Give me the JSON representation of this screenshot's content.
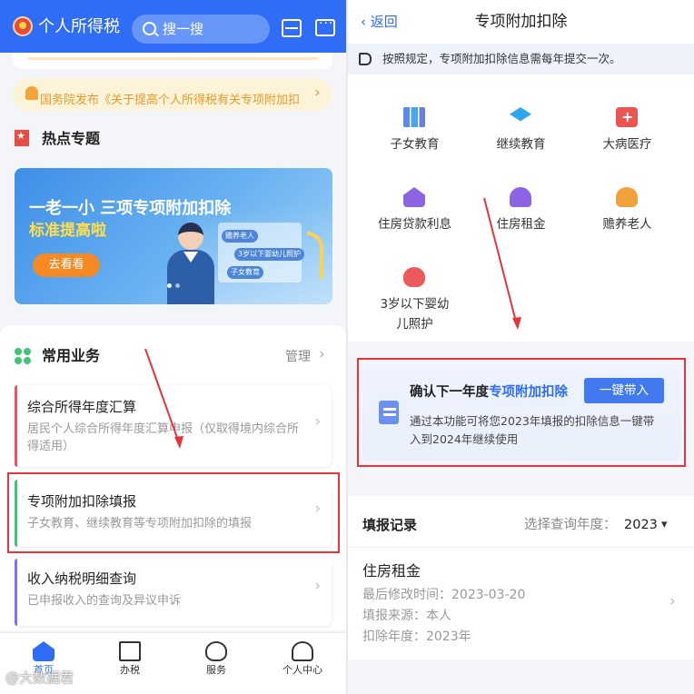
{
  "left_screen": {
    "header": {
      "app_title": "个人所得税",
      "search_placeholder": "搜一搜"
    },
    "notice": {
      "text": "国务院发布《关于提高个人所得税有关专项附加扣"
    },
    "hot_topics": {
      "title": "热点专题",
      "banner": {
        "title": "一老一小 三项专项附加扣除",
        "subtitle": "标准提高啦",
        "button": "去看看",
        "tags": [
          "赡养老人",
          "3岁以下婴幼儿照护",
          "子女教育"
        ]
      }
    },
    "common_services": {
      "title": "常用业务",
      "manage_label": "管理",
      "cards": [
        {
          "title": "综合所得年度汇算",
          "desc": "居民个人综合所得年度汇算申报（仅取得境内综合所得适用）",
          "accent": "#e8536a"
        },
        {
          "title": "专项附加扣除填报",
          "desc": "子女教育、继续教育等专项附加扣除的填报",
          "accent": "#3cc67a"
        },
        {
          "title": "收入纳税明细查询",
          "desc": "已申报收入的查询及异议申诉",
          "accent": "#8b6ef0"
        }
      ]
    },
    "tabbar": [
      {
        "label": "首页",
        "icon": "home-icon",
        "active": true
      },
      {
        "label": "办税",
        "icon": "tax-icon",
        "active": false
      },
      {
        "label": "服务",
        "icon": "service-icon",
        "active": false
      },
      {
        "label": "个人中心",
        "icon": "user-icon",
        "active": false
      }
    ],
    "watermark": "@大数据君"
  },
  "right_screen": {
    "header": {
      "back_label": "返回",
      "title": "专项附加扣除"
    },
    "tip": "按照规定，专项附加扣除信息需每年提交一次。",
    "grid": [
      {
        "label": "子女教育",
        "icon": "books-icon"
      },
      {
        "label": "继续教育",
        "icon": "graduation-cap-icon"
      },
      {
        "label": "大病医疗",
        "icon": "medical-kit-icon"
      },
      {
        "label": "住房贷款利息",
        "icon": "house-yen-icon"
      },
      {
        "label": "住房租金",
        "icon": "house-key-icon"
      },
      {
        "label": "赡养老人",
        "icon": "elderly-icon"
      },
      {
        "label": "3岁以下婴幼儿照护",
        "icon": "infant-icon"
      }
    ],
    "confirm": {
      "title_prefix": "确认下一年度",
      "title_highlight": "专项附加扣除",
      "button": "一键带入",
      "desc": "通过本功能可将您2023年填报的扣除信息一键带入到2024年继续使用"
    },
    "records": {
      "title": "填报记录",
      "year_label": "选择查询年度：",
      "year": "2023",
      "item": {
        "title": "住房租金",
        "lines": [
          {
            "label": "最后修改时间：",
            "value": "2023-03-20"
          },
          {
            "label": "填报来源：",
            "value": "本人"
          },
          {
            "label": "扣除年度：",
            "value": "2023年"
          }
        ]
      }
    }
  },
  "colors": {
    "brand_blue": "#2f6df6",
    "highlight_red": "#e8333a",
    "notice_orange": "#e69a2c"
  }
}
